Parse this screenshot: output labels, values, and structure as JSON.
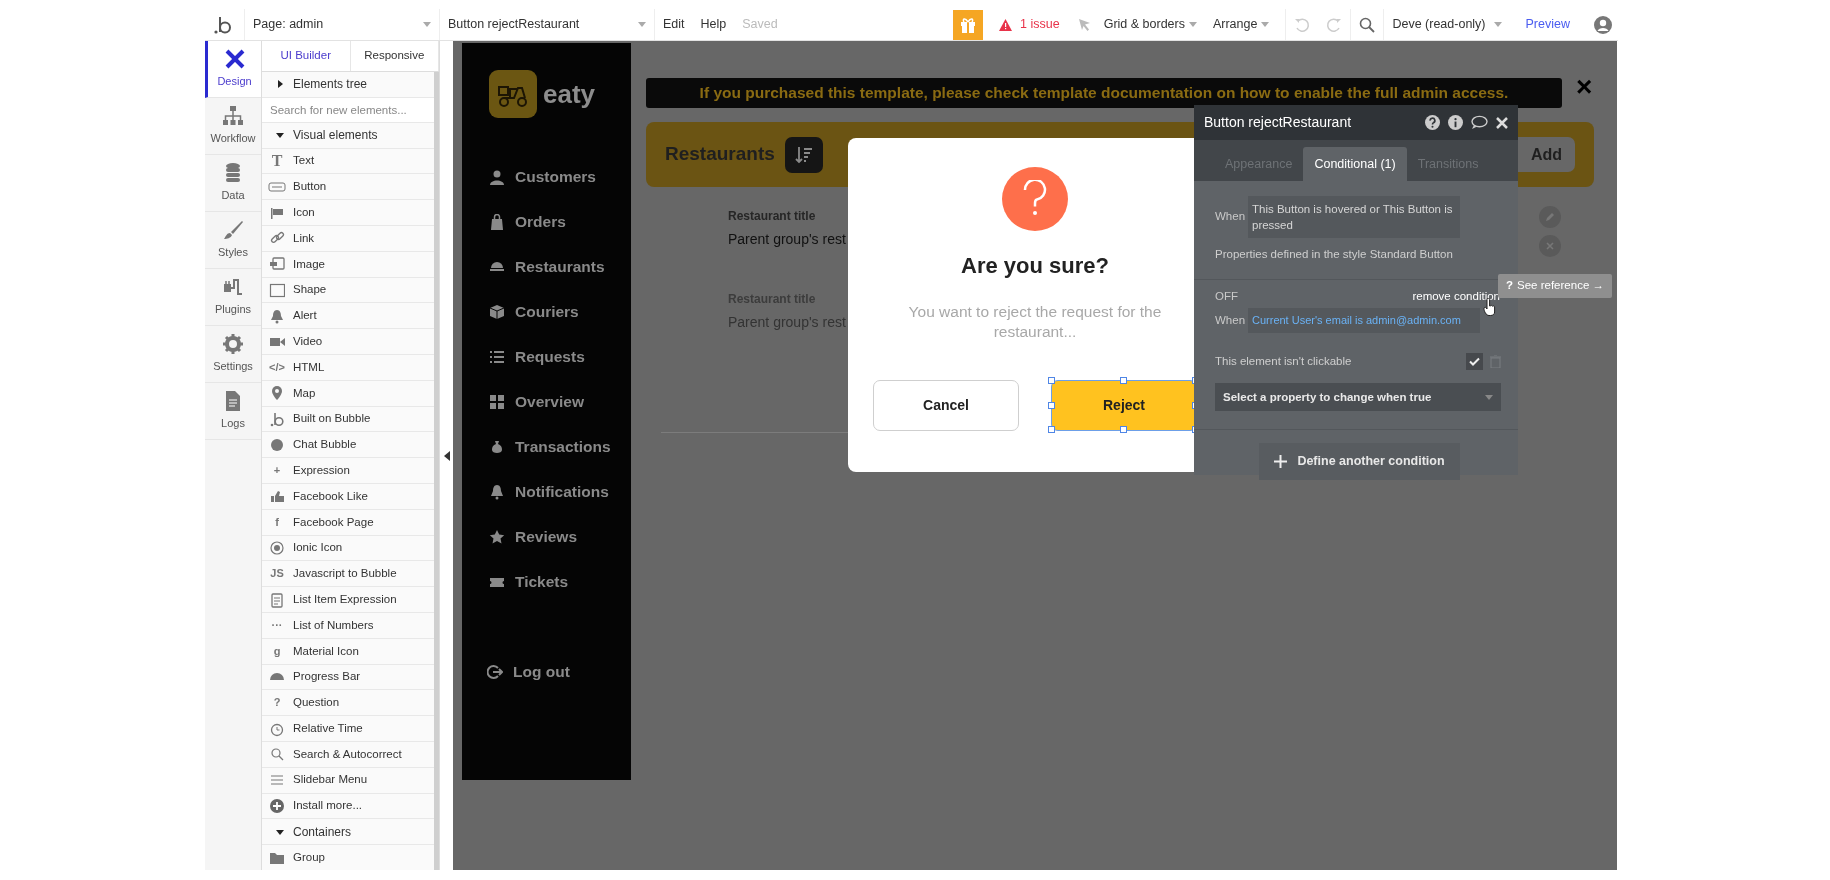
{
  "topbar": {
    "page_selector": "Page: admin",
    "element_selector": "Button rejectRestaurant",
    "menus": [
      "Edit",
      "Help"
    ],
    "save_status": "Saved",
    "issues": "1 issue",
    "tools": [
      "Grid & borders",
      "Arrange"
    ],
    "app_version": "Deve (read-only)",
    "preview": "Preview"
  },
  "tabs": [
    {
      "label": "Design",
      "selected": true
    },
    {
      "label": "Workflow",
      "selected": false
    },
    {
      "label": "Data",
      "selected": false
    },
    {
      "label": "Styles",
      "selected": false
    },
    {
      "label": "Plugins",
      "selected": false
    },
    {
      "label": "Settings",
      "selected": false
    },
    {
      "label": "Logs",
      "selected": false
    }
  ],
  "element_panel": {
    "tabs": [
      {
        "label": "UI Builder",
        "selected": true
      },
      {
        "label": "Responsive",
        "selected": false
      }
    ],
    "elements_tree": {
      "label": "Elements tree",
      "expanded": false
    },
    "search": {
      "placeholder": "Search for new elements..."
    },
    "groups": [
      {
        "label": "Visual elements",
        "expanded": true,
        "items": [
          {
            "label": "Text",
            "glyph": "T"
          },
          {
            "label": "Button"
          },
          {
            "label": "Icon"
          },
          {
            "label": "Link"
          },
          {
            "label": "Image"
          },
          {
            "label": "Shape"
          },
          {
            "label": "Alert"
          },
          {
            "label": "Video"
          },
          {
            "label": "HTML",
            "glyph": "</>"
          },
          {
            "label": "Map"
          },
          {
            "label": "Built on Bubble"
          },
          {
            "label": "Chat Bubble"
          },
          {
            "label": "Expression",
            "glyph": "+"
          },
          {
            "label": "Facebook Like"
          },
          {
            "label": "Facebook Page",
            "glyph": "f"
          },
          {
            "label": "Ionic Icon"
          },
          {
            "label": "Javascript to Bubble",
            "glyph": "JS"
          },
          {
            "label": "List Item Expression"
          },
          {
            "label": "List of Numbers",
            "glyph": "···"
          },
          {
            "label": "Material Icon",
            "glyph": "g"
          },
          {
            "label": "Progress Bar"
          },
          {
            "label": "Question",
            "glyph": "?"
          },
          {
            "label": "Relative Time"
          },
          {
            "label": "Search & Autocorrect"
          },
          {
            "label": "Slidebar Menu"
          },
          {
            "label": "Install more..."
          }
        ]
      },
      {
        "label": "Containers",
        "expanded": true,
        "items": [
          {
            "label": "Group"
          }
        ]
      }
    ]
  },
  "app": {
    "logo_text": "eaty",
    "nav": [
      "Customers",
      "Orders",
      "Restaurants",
      "Couriers",
      "Requests",
      "Overview",
      "Transactions",
      "Notifications",
      "Reviews",
      "Tickets"
    ],
    "logout": "Log out",
    "banner": "If you purchased this template, please check template documentation on how to enable the full admin access.",
    "close_glyph": "×",
    "page_title": "Restaurants",
    "add_button": "Add",
    "rows": [
      {
        "label": "Restaurant title",
        "value": "Parent group's rest",
        "faded": false
      },
      {
        "label": "Restaurant title",
        "value": "Parent group's rest",
        "faded": true
      }
    ]
  },
  "dialog": {
    "title": "Are you sure?",
    "message": "You want to reject the request for the restaurant...",
    "buttons": [
      {
        "label": "Cancel",
        "kind": "outline",
        "selected": false
      },
      {
        "label": "Reject",
        "kind": "primary",
        "selected": true
      }
    ]
  },
  "property_editor": {
    "title": "Button rejectRestaurant",
    "tabs": [
      {
        "label": "Appearance",
        "selected": false
      },
      {
        "label": "Conditional (1)",
        "selected": true
      },
      {
        "label": "Transitions",
        "selected": false
      }
    ],
    "conditions": [
      {
        "kind": "style",
        "when_label": "When",
        "condition": "This Button is hovered or This Button is pressed",
        "note": "Properties defined in the style Standard Button"
      },
      {
        "kind": "custom",
        "status": "OFF",
        "remove": "remove condition",
        "when_label": "When",
        "condition": "Current User's email is admin@admin.com",
        "properties": [
          {
            "label": "This element isn't clickable",
            "checked": true
          }
        ],
        "property_select": "Select a property to change when true"
      }
    ],
    "add_condition": "Define another condition"
  },
  "tooltip": {
    "glyph": "?",
    "text": "See reference →"
  }
}
